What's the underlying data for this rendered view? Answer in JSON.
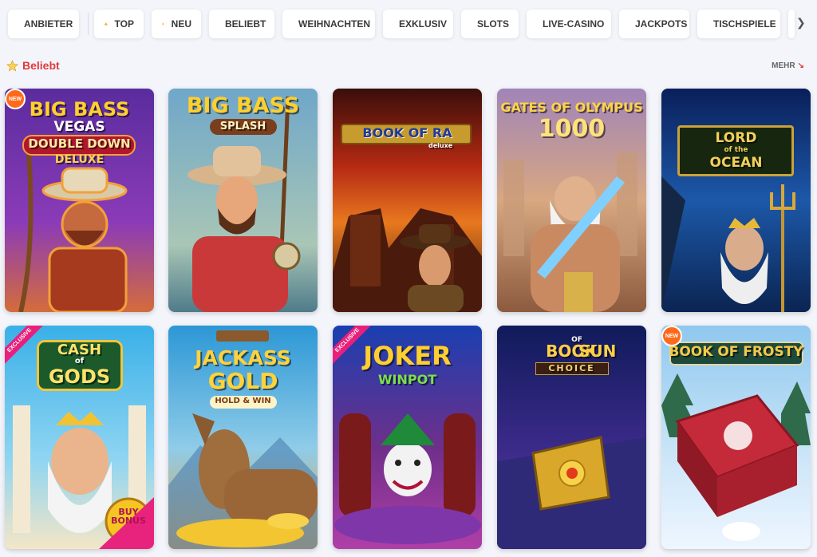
{
  "categories": [
    {
      "label": "ANBIETER",
      "icon": "provider-icon"
    },
    {
      "label": "TOP",
      "icon": "top-icon"
    },
    {
      "label": "NEU",
      "icon": "new-flame-icon"
    },
    {
      "label": "BELIEBT",
      "icon": "star-icon"
    },
    {
      "label": "WEIHNACHTEN",
      "icon": "christmas-pudding-icon"
    },
    {
      "label": "EXKLUSIV",
      "icon": "exclusive-icon"
    },
    {
      "label": "SLOTS",
      "icon": "slots-icon"
    },
    {
      "label": "LIVE-CASINO",
      "icon": "live-casino-icon"
    },
    {
      "label": "JACKPOTS",
      "icon": "coins-icon"
    },
    {
      "label": "TISCHSPIELE",
      "icon": "table-games-icon"
    }
  ],
  "section": {
    "title": "Beliebt",
    "more_label": "MEHR"
  },
  "games": [
    {
      "title_line1": "BIG BASS",
      "title_line2": "VEGAS",
      "title_line3": "DOUBLE DOWN",
      "title_line4": "DELUXE",
      "badge": "NEW"
    },
    {
      "title_line1": "BIG BASS",
      "title_line2": "SPLASH"
    },
    {
      "title_line1": "BOOK OF RA",
      "title_line2": "deluxe"
    },
    {
      "title_line1": "GATES OF OLYMPUS",
      "title_line2": "1000"
    },
    {
      "title_line1": "LORD",
      "title_line2": "of the",
      "title_line3": "OCEAN"
    },
    {
      "title_line1": "CASH",
      "title_line2": "of",
      "title_line3": "GODS",
      "badge": "EXCLUSIVE",
      "extra": "BUY BONUS"
    },
    {
      "title_line1": "JACKASS",
      "title_line2": "GOLD",
      "title_line3": "HOLD & WIN"
    },
    {
      "title_line1": "JOKER",
      "title_line2": "WINPOT",
      "badge": "EXCLUSIVE"
    },
    {
      "title_line1": "BOOK",
      "title_line2": "OF",
      "title_line3": "SUN",
      "title_line4": "CHOICE"
    },
    {
      "title_line1": "BOOK OF FROSTY",
      "badge": "NEW"
    }
  ]
}
